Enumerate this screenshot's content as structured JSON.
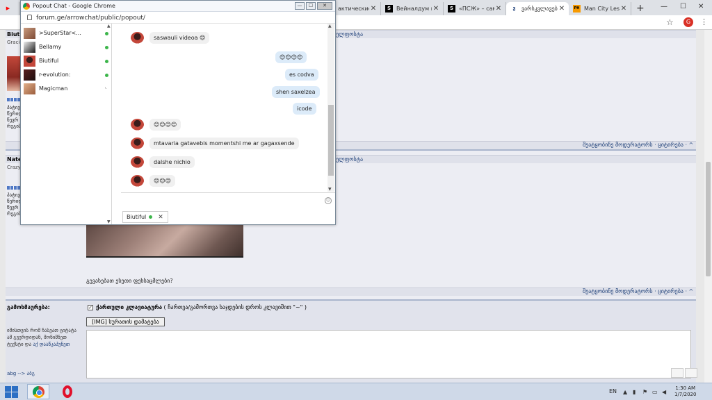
{
  "browser": {
    "tabs": [
      {
        "title": "",
        "icon": "youtube-icon",
        "fav_text": "▶",
        "fav_color": "#ff0000",
        "active": false
      },
      {
        "title": "актические и",
        "icon": "page-icon",
        "fav_text": "",
        "fav_color": "#888888",
        "active": false
      },
      {
        "title": "Вейналдум и",
        "icon": "sports-site-icon",
        "fav_text": "S",
        "fav_color": "#000000",
        "active": false
      },
      {
        "title": "«ПСЖ» – сам",
        "icon": "sports-site-icon",
        "fav_text": "S",
        "fav_color": "#000000",
        "active": false
      },
      {
        "title": "ვარსკვლავებ",
        "icon": "forum-icon",
        "fav_text": "ვ",
        "fav_color": "#1d3f78",
        "active": true
      },
      {
        "title": "Man City Lesb",
        "icon": "ph-icon",
        "fav_text": "PH",
        "fav_color": "#f79a00",
        "active": false
      }
    ],
    "new_tab": "+",
    "window_controls": [
      "—",
      "☐",
      "✕"
    ],
    "profile_initial": "G",
    "profile_color": "#d93025"
  },
  "popout": {
    "title": "Popout Chat - Google Chrome",
    "url": "forum.ge/arrowchat/public/popout/",
    "buddies": [
      {
        "name": ">SuperStar<...",
        "status": "online"
      },
      {
        "name": "Bellamy",
        "status": "online"
      },
      {
        "name": "Biutiful",
        "status": "online"
      },
      {
        "name": "r-evolution:",
        "status": "online"
      },
      {
        "name": "Magicman",
        "status": "idle"
      }
    ],
    "messages": [
      {
        "dir": "in",
        "text": "saswauli videoa 😊"
      },
      {
        "dir": "out",
        "text": "😊😊😊😊"
      },
      {
        "dir": "out",
        "text": "es codva"
      },
      {
        "dir": "out",
        "text": "shen saxelzea"
      },
      {
        "dir": "out",
        "text": "icode"
      },
      {
        "dir": "in",
        "text": "😊😊😊😊"
      },
      {
        "dir": "in",
        "text": "mtavaria gatavebis momentshi me ar gagaxsende"
      },
      {
        "dir": "in",
        "text": "dalshe nichio"
      },
      {
        "dir": "in",
        "text": "😊😊😊"
      }
    ],
    "active_tab": "Biutiful"
  },
  "forum": {
    "post1": {
      "author": "Biuti",
      "author_sub": "Gracia",
      "links": "· ელფოსტა",
      "footer": "შეატყობინე მოდერატორს · ციტირება · ^",
      "side_lines": [
        "პატივ",
        "წერილ",
        "წევრ",
        "რეგის"
      ]
    },
    "post2": {
      "author": "Nate",
      "author_sub": "Crazy",
      "links": "· ელფოსტა",
      "footer": "შეატყობინე მოდერატორს · ციტირება · ^",
      "side_lines": [
        "პატივ",
        "წერილ",
        "წევრ",
        "რეგის"
      ],
      "question": "გევასებათ ესეთი ფეხსაცმლები?"
    },
    "reply": {
      "label": "გამოხმაურება:",
      "keyboard_title": "ქართული კლავიატურა",
      "keyboard_hint": "( ჩართვა/გამორთვა ხაჯდების დროს კლავიშით \"~\" )",
      "img_button": "[IMG] სურათის დამატება",
      "help_text": "იმისთვის რომ ჩასვათ ციტატა ამ გვერდიდან, მონიშნეთ ტექსტი და",
      "help_link": "აქ დააწკაპუნეთ",
      "abg": "abg --> აბგ"
    }
  },
  "taskbar": {
    "apps": [
      "chrome",
      "opera"
    ],
    "language": "EN",
    "time": "1:30 AM",
    "date": "1/7/2020"
  }
}
